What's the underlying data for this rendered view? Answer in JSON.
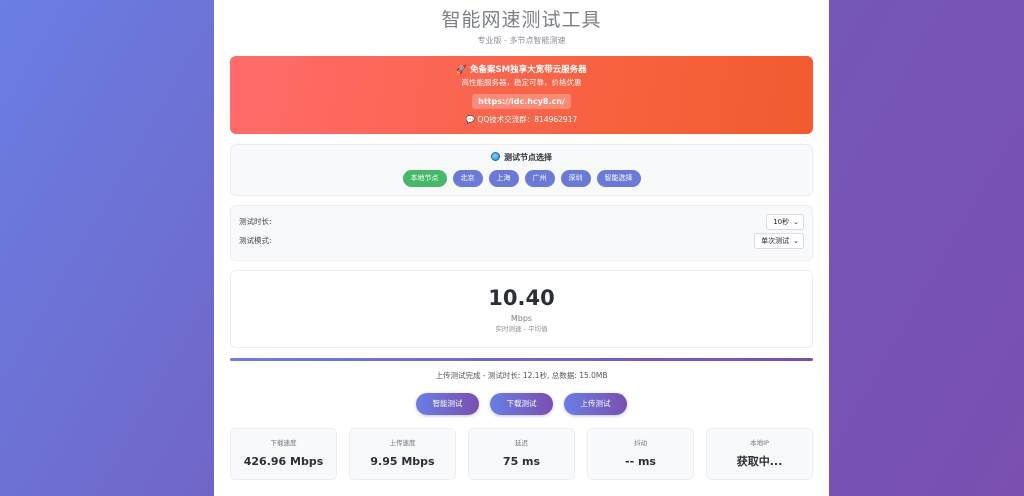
{
  "header": {
    "title": "智能网速测试工具",
    "subtitle": "专业版 - 多节点智能测速"
  },
  "promo": {
    "icon": "rocket-icon",
    "title": "免备案SM独享大宽带云服务器",
    "subtitle": "高性能服务器，稳定可靠，价格优惠",
    "link": "https://idc.hcy8.cn/",
    "qq_icon": "chat-icon",
    "qq": "QQ技术交流群：814962917",
    "color": "#f7613c"
  },
  "nodes": {
    "title": "测试节点选择",
    "items": [
      {
        "label": "本地节点",
        "active": true
      },
      {
        "label": "北京",
        "active": false
      },
      {
        "label": "上海",
        "active": false
      },
      {
        "label": "广州",
        "active": false
      },
      {
        "label": "深圳",
        "active": false
      },
      {
        "label": "智能选择",
        "active": false
      }
    ]
  },
  "settings": {
    "duration_label": "测试时长:",
    "duration_value": "10秒",
    "mode_label": "测试模式:",
    "mode_value": "单次测试"
  },
  "speed": {
    "value": "10.40",
    "unit": "Mbps",
    "note": "实时测速 - 平均值"
  },
  "progress": {
    "percent": 100
  },
  "status": {
    "text": "上传测试完成 - 测试时长: 12.1秒, 总数据: 15.0MB"
  },
  "actions": {
    "smart": "智能测试",
    "download": "下载测试",
    "upload": "上传测试"
  },
  "stats": [
    {
      "label": "下载速度",
      "value": "426.96 Mbps"
    },
    {
      "label": "上传速度",
      "value": "9.95 Mbps"
    },
    {
      "label": "延迟",
      "value": "75 ms"
    },
    {
      "label": "抖动",
      "value": "-- ms"
    },
    {
      "label": "本地IP",
      "value": "获取中..."
    }
  ]
}
